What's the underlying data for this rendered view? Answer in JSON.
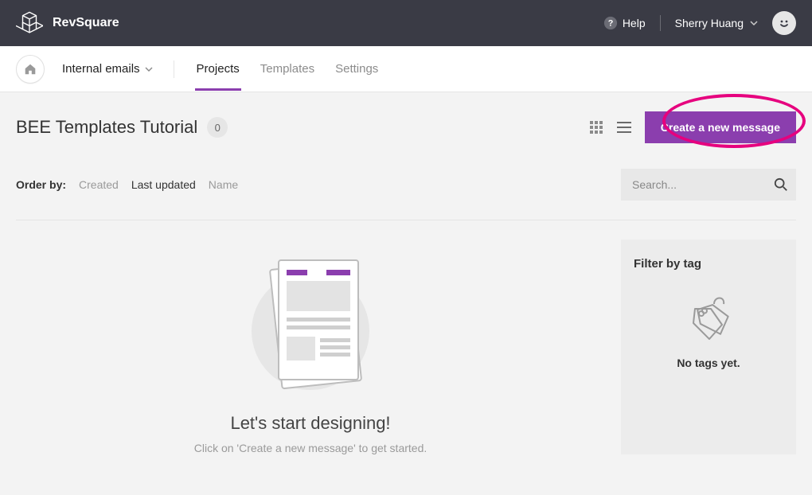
{
  "brand": "RevSquare",
  "help_label": "Help",
  "user_name": "Sherry Huang",
  "workspace_name": "Internal emails",
  "nav_tabs": {
    "projects": "Projects",
    "templates": "Templates",
    "settings": "Settings"
  },
  "page_title": "BEE Templates Tutorial",
  "item_count": "0",
  "create_button": "Create a new message",
  "order_by_label": "Order by:",
  "order_options": {
    "created": "Created",
    "last_updated": "Last updated",
    "name": "Name"
  },
  "search_placeholder": "Search...",
  "empty_state": {
    "title": "Let's start designing!",
    "subtitle": "Click on 'Create a new message' to get started."
  },
  "tag_panel": {
    "title": "Filter by tag",
    "empty": "No tags yet."
  },
  "colors": {
    "accent": "#8b3eae",
    "highlight": "#e6007e",
    "topbar": "#3a3b45"
  }
}
